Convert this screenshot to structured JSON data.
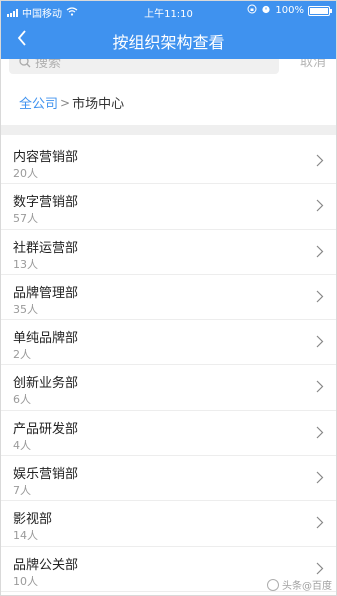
{
  "status_bar": {
    "carrier": "中国移动",
    "time": "上午11:10",
    "battery_percent": "100%",
    "icons": [
      "signal-icon",
      "wifi-icon",
      "rotation-lock-icon",
      "alarm-icon",
      "battery-icon"
    ]
  },
  "nav": {
    "title": "按组织架构查看",
    "back_icon": "chevron-left-icon"
  },
  "search": {
    "placeholder": "搜索",
    "cancel_label": "取消"
  },
  "breadcrumb": {
    "root": "全公司",
    "separator": ">",
    "current": "市场中心"
  },
  "departments": [
    {
      "name": "内容营销部",
      "count": "20人"
    },
    {
      "name": "数字营销部",
      "count": "57人"
    },
    {
      "name": "社群运营部",
      "count": "13人"
    },
    {
      "name": "品牌管理部",
      "count": "35人"
    },
    {
      "name": "单纯品牌部",
      "count": "2人"
    },
    {
      "name": "创新业务部",
      "count": "6人"
    },
    {
      "name": "产品研发部",
      "count": "4人"
    },
    {
      "name": "娱乐营销部",
      "count": "7人"
    },
    {
      "name": "影视部",
      "count": "14人"
    },
    {
      "name": "品牌公关部",
      "count": "10人"
    }
  ],
  "watermark": "头条@百度",
  "colors": {
    "header_bg": "#3f92ef",
    "breadcrumb_link": "#3f92ef",
    "divider": "#efefef"
  }
}
